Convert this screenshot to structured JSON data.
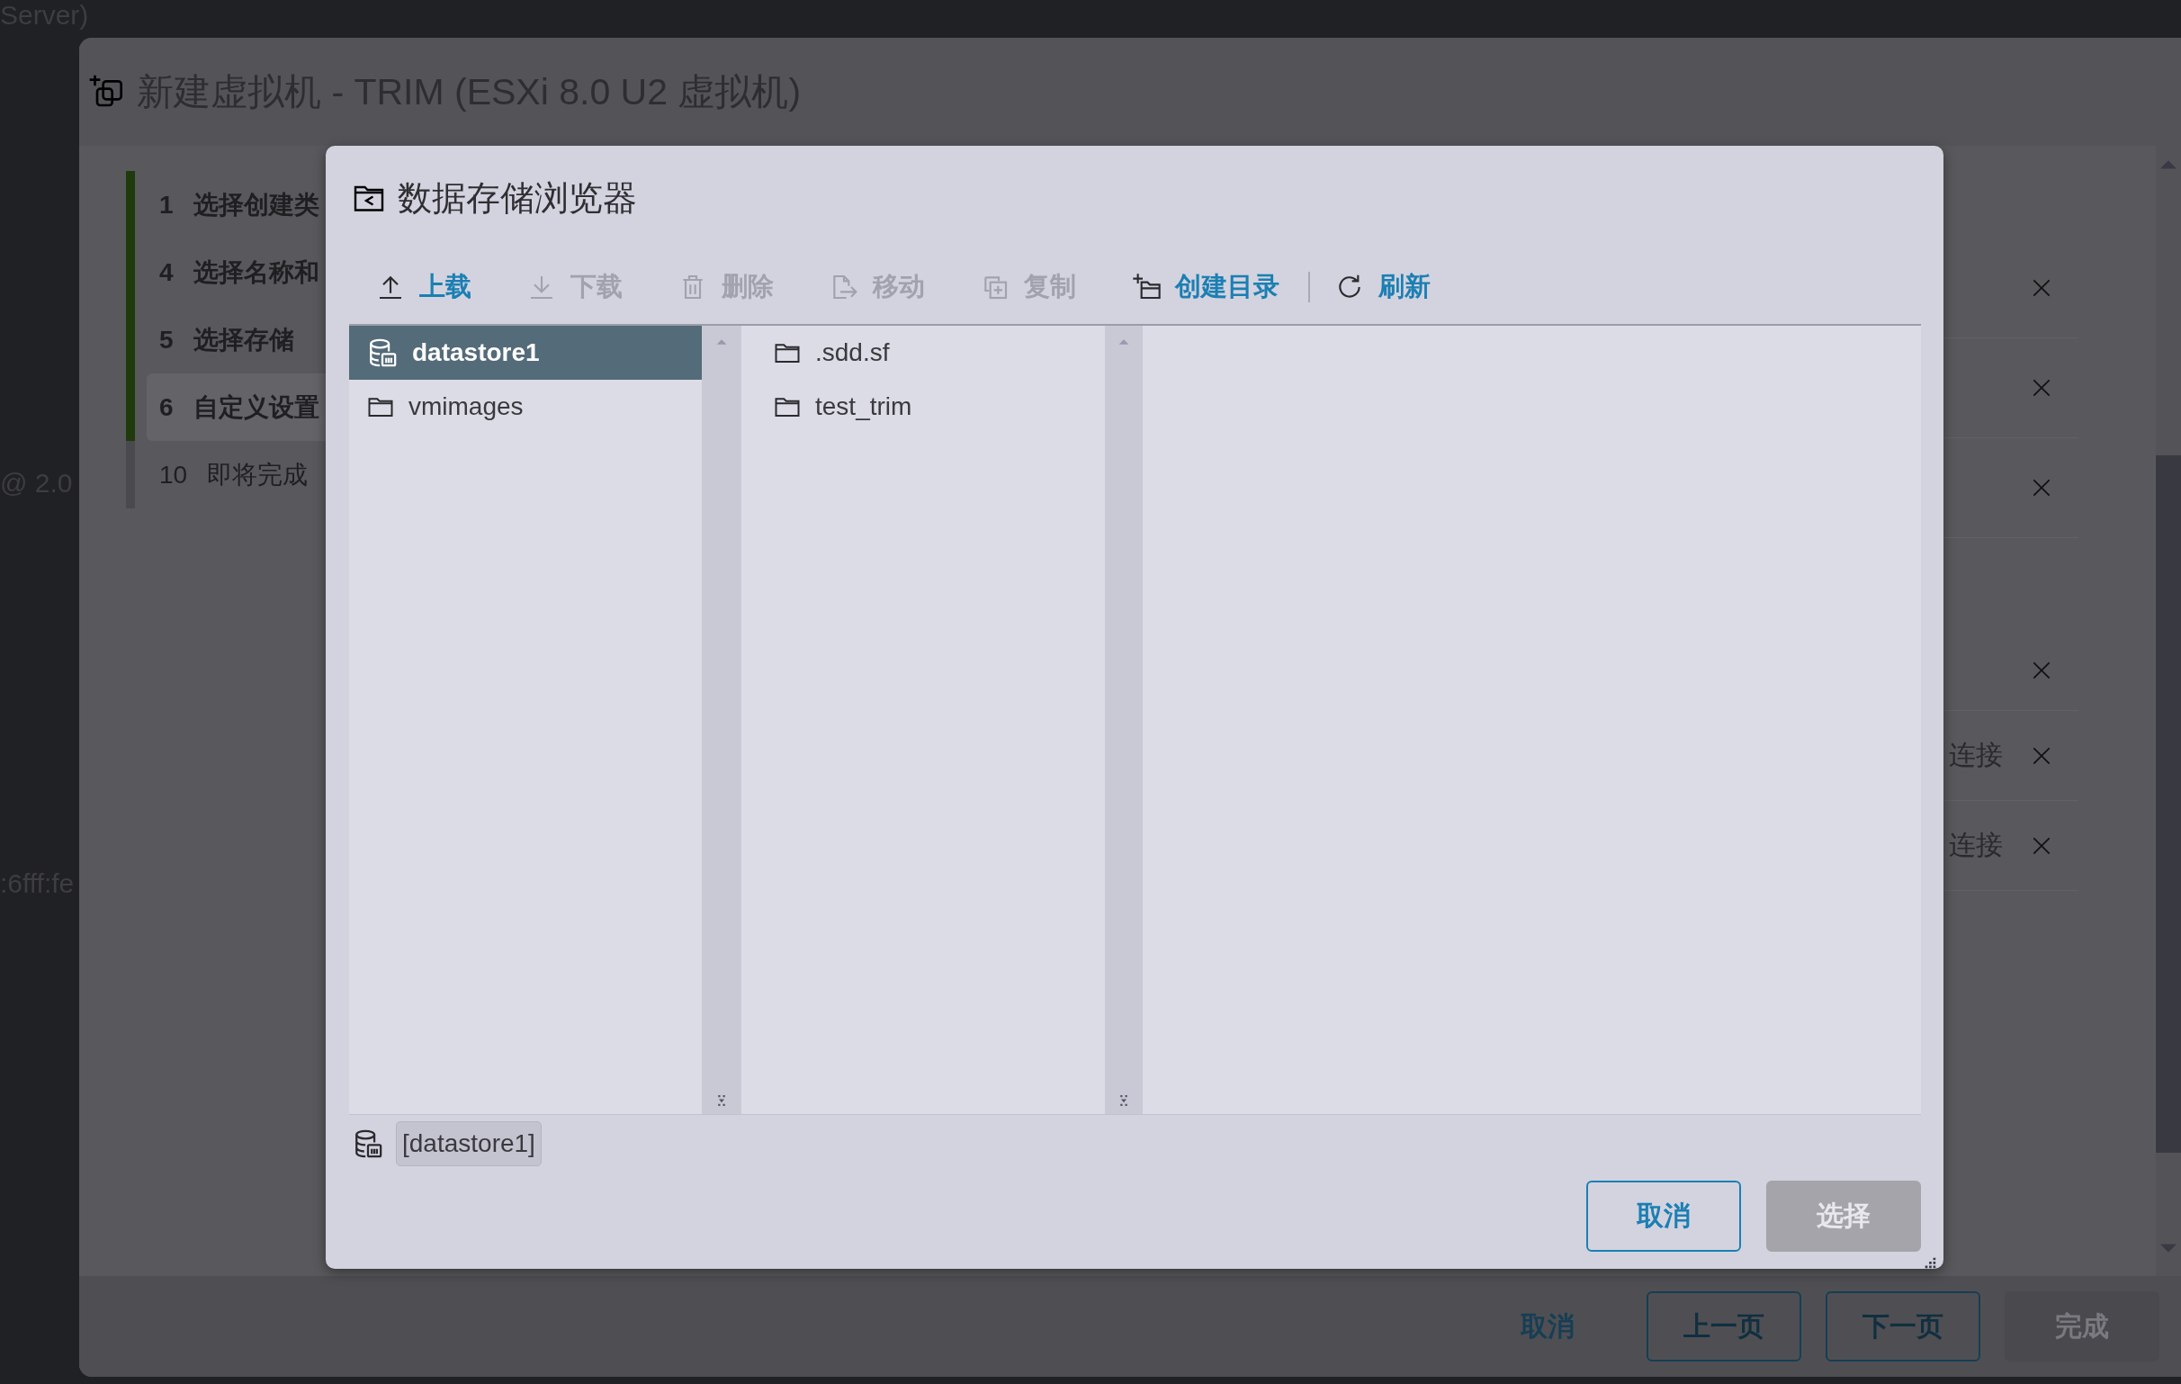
{
  "background": {
    "texts": [
      "Server)",
      "@ 2.0",
      ":6fff:fe"
    ]
  },
  "wizard": {
    "title": "新建虚拟机 - TRIM (ESXi 8.0 U2 虚拟机)",
    "steps": [
      {
        "number": "1",
        "label": "选择创建类",
        "completed": true,
        "selected": false
      },
      {
        "number": "4",
        "label": "选择名称和",
        "completed": true,
        "selected": false
      },
      {
        "number": "5",
        "label": "选择存储",
        "completed": true,
        "selected": false
      },
      {
        "number": "6",
        "label": "自定义设置",
        "completed": true,
        "selected": true
      },
      {
        "number": "10",
        "label": "即将完成",
        "completed": false,
        "selected": false
      }
    ],
    "device_rows": [
      {
        "removable": true
      },
      {
        "removable": true
      },
      {
        "removable": true
      },
      {
        "removable": true
      },
      {
        "removable": true,
        "status": "连接"
      },
      {
        "removable": true,
        "status": "连接"
      }
    ],
    "footer": {
      "cancel": "取消",
      "buttons": [
        {
          "label": "上一页",
          "disabled": false
        },
        {
          "label": "下一页",
          "disabled": false
        },
        {
          "label": "完成",
          "disabled": true
        }
      ]
    }
  },
  "dialog": {
    "title": "数据存储浏览器",
    "toolbar": [
      {
        "label": "上载",
        "disabled": false,
        "separator_before": false
      },
      {
        "label": "下载",
        "disabled": true,
        "separator_before": false
      },
      {
        "label": "删除",
        "disabled": true,
        "separator_before": false
      },
      {
        "label": "移动",
        "disabled": true,
        "separator_before": false
      },
      {
        "label": "复制",
        "disabled": true,
        "separator_before": false
      },
      {
        "label": "创建目录",
        "disabled": false,
        "separator_before": false
      },
      {
        "label": "刷新",
        "disabled": false,
        "separator_before": true
      }
    ],
    "columns": [
      {
        "items": [
          {
            "name": "datastore1",
            "kind": "datastore",
            "selected": true
          },
          {
            "name": "vmimages",
            "kind": "folder",
            "selected": false
          }
        ]
      },
      {
        "items": [
          {
            "name": ".sdd.sf",
            "kind": "folder",
            "selected": false
          },
          {
            "name": "test_trim",
            "kind": "folder",
            "selected": false
          }
        ]
      }
    ],
    "path": "[datastore1]",
    "buttons": [
      {
        "label": "取消",
        "kind": "secondary",
        "disabled": false
      },
      {
        "label": "选择",
        "kind": "primary",
        "disabled": true
      }
    ]
  }
}
